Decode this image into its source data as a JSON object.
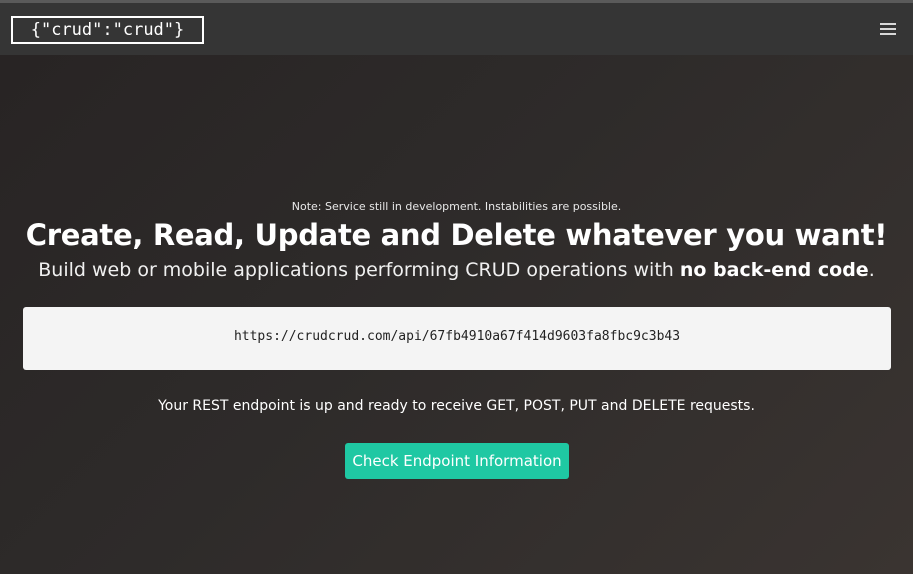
{
  "navbar": {
    "brand_label": "{\"crud\":\"crud\"}",
    "menu_icon": "hamburger-menu-icon"
  },
  "hero": {
    "note": "Note: Service still in development. Instabilities are possible.",
    "headline": "Create, Read, Update and Delete whatever you want!",
    "subline_prefix": "Build web or mobile applications performing CRUD operations with ",
    "subline_bold": "no back-end code",
    "subline_suffix": ".",
    "endpoint_url": "https://crudcrud.com/api/67fb4910a67f414d9603fa8fbc9c3b43",
    "status_text": "Your REST endpoint is up and ready to receive GET, POST, PUT and DELETE requests.",
    "cta_label": "Check Endpoint Information"
  },
  "colors": {
    "navbar_bg": "#353535",
    "hero_bg": "#2a2726",
    "accent": "#1fc8a3",
    "endpoint_box_bg": "#f4f4f4"
  }
}
